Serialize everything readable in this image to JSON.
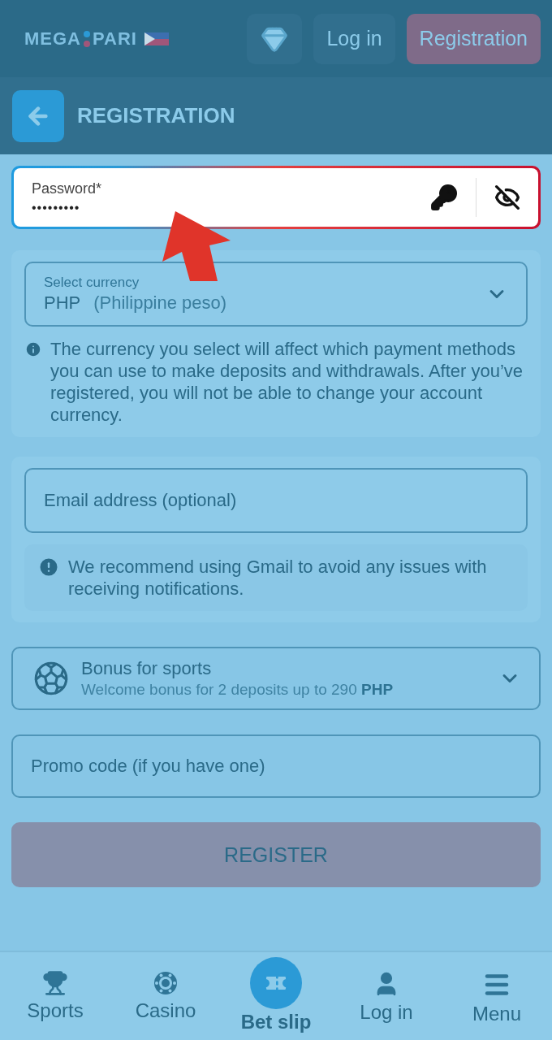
{
  "header": {
    "logo": {
      "left": "MEGA",
      "right": "PARI"
    },
    "buttons": [
      {
        "kind": "icon"
      },
      {
        "kind": "text",
        "label": "Log in"
      },
      {
        "kind": "accent",
        "label": "Registration"
      }
    ]
  },
  "subheader": {
    "title": "REGISTRATION"
  },
  "password": {
    "label": "Password*",
    "value": "•••••••••"
  },
  "currency": {
    "label": "Select currency",
    "code": "PHP",
    "name": "(Philippine peso)",
    "note": "The currency you select will affect which payment methods you can use to make deposits and withdrawals. After you’ve registered, you will not be able to change your account currency."
  },
  "email": {
    "placeholder": "Email address (optional)",
    "note": "We recommend using Gmail to avoid any issues with receiving notifications."
  },
  "bonus": {
    "title": "Bonus for sports",
    "subtitle": "Welcome bonus for 2 deposits up to 290 **PHP**"
  },
  "promo": {
    "placeholder": "Promo code (if you have one)"
  },
  "register": {
    "label": "REGISTER"
  },
  "bottom_nav": [
    {
      "label": "Sports",
      "selected": false
    },
    {
      "label": "Casino",
      "selected": false
    },
    {
      "label": "Bet slip",
      "selected": true
    },
    {
      "label": "Log in",
      "selected": false
    },
    {
      "label": "Menu",
      "selected": false
    }
  ]
}
